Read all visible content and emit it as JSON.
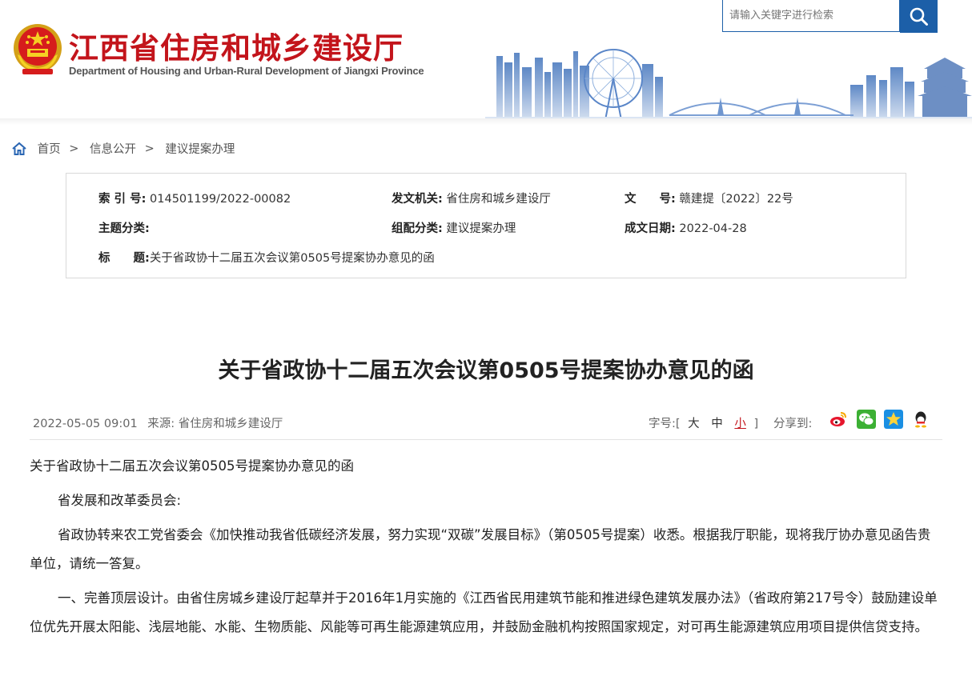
{
  "header": {
    "site_title": "江西省住房和城乡建设厅",
    "site_subtitle": "Department of Housing and Urban-Rural Development of Jiangxi Province",
    "search_placeholder": "请输入关键字进行检索",
    "brand_color": "#c3141b",
    "accent_color": "#1c5fa8",
    "emblem_icon": "national-emblem-icon",
    "search_icon": "search-icon"
  },
  "breadcrumb": {
    "home": "首页",
    "separator": ">",
    "level1": "信息公开",
    "level2": "建议提案办理"
  },
  "meta": {
    "index_label": "索 引 号:",
    "index_value": "014501199/2022-00082",
    "issuer_label": "发文机关:",
    "issuer_value": "省住房和城乡建设厅",
    "docno_label": "文　　号:",
    "docno_value": "赣建提〔2022〕22号",
    "topic_label": "主题分类:",
    "topic_value": "",
    "group_label": "组配分类:",
    "group_value": "建议提案办理",
    "date_label": "成文日期:",
    "date_value": "2022-04-28",
    "title_label": "标　　题:",
    "title_value": "关于省政协十二届五次会议第0505号提案协办意见的函"
  },
  "article": {
    "title": "关于省政协十二届五次会议第0505号提案协办意见的函",
    "publish_time": "2022-05-05 09:01",
    "source_label": "来源:",
    "source_value": "省住房和城乡建设厅",
    "font_size_label": "字号:",
    "font_size_open": "[",
    "font_size_options": [
      "大",
      "中",
      "小"
    ],
    "font_size_close": "]",
    "share_label": "分享到:",
    "share_icons": [
      "weibo-icon",
      "wechat-icon",
      "qzone-icon",
      "qq-icon"
    ],
    "paragraphs": [
      "关于省政协十二届五次会议第0505号提案协办意见的函",
      "省发展和改革委员会:",
      "省政协转来农工党省委会《加快推动我省低碳经济发展，努力实现“双碳”发展目标》（第0505号提案）收悉。根据我厅职能，现将我厅协办意见函告贵单位，请统一答复。",
      "一、完善顶层设计。由省住房城乡建设厅起草并于2016年1月实施的《江西省民用建筑节能和推进绿色建筑发展办法》（省政府第217号令）鼓励建设单位优先开展太阳能、浅层地能、水能、生物质能、风能等可再生能源建筑应用，并鼓励金融机构按照国家规定，对可再生能源建筑应用项目提供信贷支持。"
    ]
  }
}
